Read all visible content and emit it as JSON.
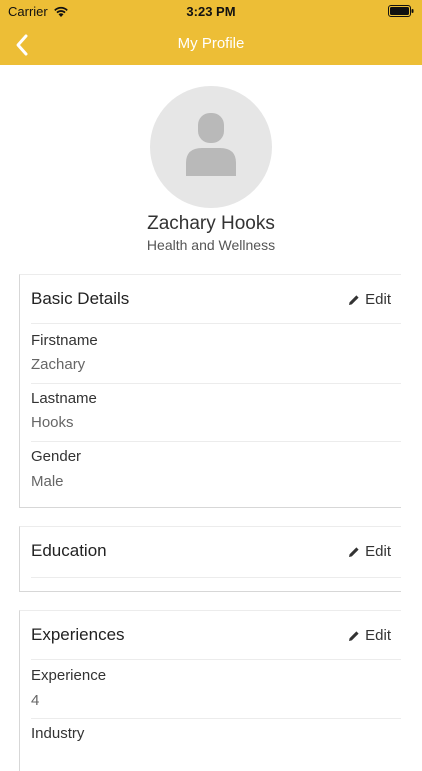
{
  "status_bar": {
    "carrier": "Carrier",
    "time": "3:23 PM"
  },
  "nav": {
    "title": "My Profile",
    "back_icon": "chevron-left-icon"
  },
  "profile": {
    "name": "Zachary Hooks",
    "department": "Health and Wellness"
  },
  "sections": {
    "basic": {
      "title": "Basic Details",
      "edit_label": "Edit",
      "fields": [
        {
          "label": "Firstname",
          "value": "Zachary"
        },
        {
          "label": "Lastname",
          "value": "Hooks"
        },
        {
          "label": "Gender",
          "value": "Male"
        }
      ]
    },
    "education": {
      "title": "Education",
      "edit_label": "Edit"
    },
    "experiences": {
      "title": "Experiences",
      "edit_label": "Edit",
      "fields": [
        {
          "label": "Experience",
          "value": "4"
        },
        {
          "label": "Industry",
          "value": ""
        }
      ]
    }
  },
  "colors": {
    "header": "#EDBE36",
    "avatar_bg": "#E6E6E6",
    "avatar_silhouette": "#B9B9B9"
  }
}
